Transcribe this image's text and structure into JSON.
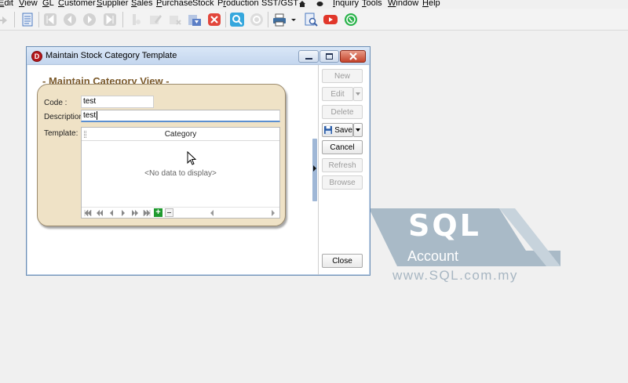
{
  "menu": [
    {
      "label": "Edit",
      "mnemonic": "E"
    },
    {
      "label": "View",
      "mnemonic": "V"
    },
    {
      "label": "GL",
      "mnemonic": "G"
    },
    {
      "label": "Customer",
      "mnemonic": "C"
    },
    {
      "label": "Supplier",
      "mnemonic": "S"
    },
    {
      "label": "Sales",
      "mnemonic": "S"
    },
    {
      "label": "Purchase",
      "mnemonic": "P"
    },
    {
      "label": "Stock",
      "mnemonic": ""
    },
    {
      "label": "Production",
      "mnemonic": "r"
    },
    {
      "label": "SST/GST",
      "mnemonic": ""
    },
    {
      "label": "Inquiry",
      "mnemonic": "I"
    },
    {
      "label": "Tools",
      "mnemonic": "T"
    },
    {
      "label": "Window",
      "mnemonic": "W"
    },
    {
      "label": "Help",
      "mnemonic": "H"
    }
  ],
  "toolbar_icons": [
    "open-icon",
    "document-icon",
    "first-record-icon",
    "previous-record-icon",
    "next-record-icon",
    "last-record-icon",
    "tool-icon",
    "edit-icon",
    "delete-icon",
    "download-icon",
    "cancel-icon",
    "find-icon",
    "refresh-icon",
    "print-icon",
    "preview-icon",
    "youtube-icon",
    "whatsapp-icon"
  ],
  "dialog": {
    "title": "Maintain Stock Category Template",
    "view_title": "- Maintain Category View -",
    "code_label": "Code :",
    "code_value": "test",
    "description_label": "Description:",
    "description_value": "test",
    "template_label": "Template:",
    "grid": {
      "column": "Category",
      "empty_text": "<No data to display>"
    },
    "buttons": {
      "new": "New",
      "edit": "Edit",
      "delete": "Delete",
      "save": "Save",
      "cancel": "Cancel",
      "refresh": "Refresh",
      "browse": "Browse",
      "close": "Close"
    }
  },
  "watermark": {
    "logo": "SQL",
    "product": "Account",
    "url": "www.SQL.com.my"
  },
  "colors": {
    "panel": "#efe2c6",
    "view_title": "#7c5a2a",
    "title_bar": "#c4d6ee",
    "watermark": "#8fa3b4"
  }
}
